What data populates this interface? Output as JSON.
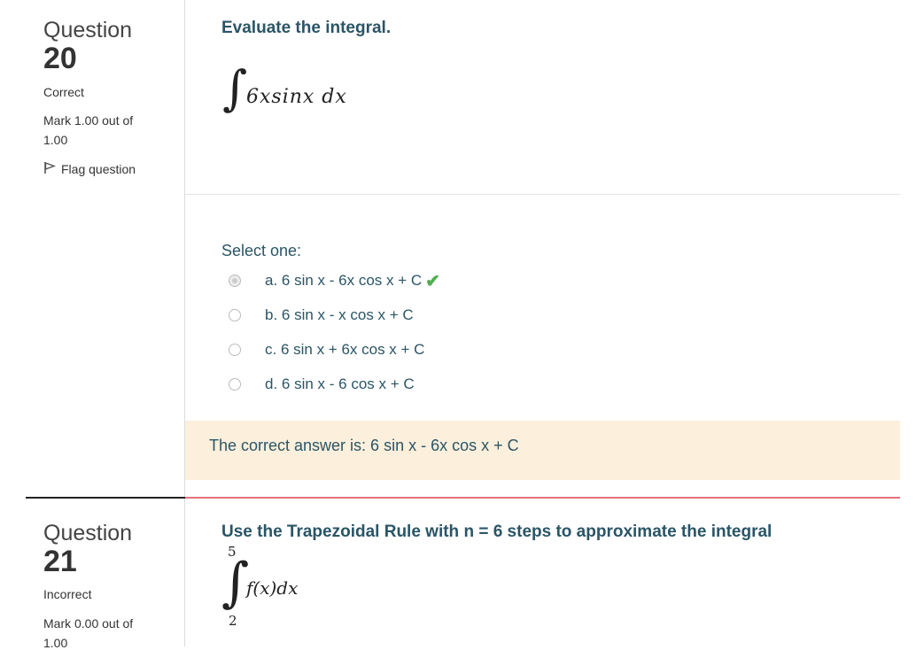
{
  "question20": {
    "label": "Question",
    "number": "20",
    "status": "Correct",
    "mark_line1": "Mark 1.00 out of",
    "mark_line2": "1.00",
    "flag_label": "Flag question",
    "prompt": "Evaluate the integral.",
    "integral_expr": "6xsinx dx",
    "select_label": "Select one:",
    "options": [
      {
        "label": "a. 6 sin x - 6x cos x + C",
        "selected": true,
        "correct": true
      },
      {
        "label": "b. 6 sin x - x cos x + C",
        "selected": false
      },
      {
        "label": "c. 6 sin x + 6x cos x + C",
        "selected": false
      },
      {
        "label": "d. 6 sin x - 6 cos x + C",
        "selected": false
      }
    ],
    "feedback": "The correct answer is: 6 sin x - 6x cos x + C"
  },
  "question21": {
    "label": "Question",
    "number": "21",
    "status": "Incorrect",
    "mark_line1": "Mark 0.00 out of",
    "mark_line2": "1.00",
    "prompt": "Use the Trapezoidal Rule with n = 6 steps to approximate the integral",
    "upper_limit": "5",
    "lower_limit": "2",
    "integral_expr": "f(x)dx"
  },
  "colors": {
    "heading": "#2a5566",
    "feedback_bg": "#fcefdc",
    "check": "#4fae4f",
    "incorrect_rule": "#e5727d"
  }
}
